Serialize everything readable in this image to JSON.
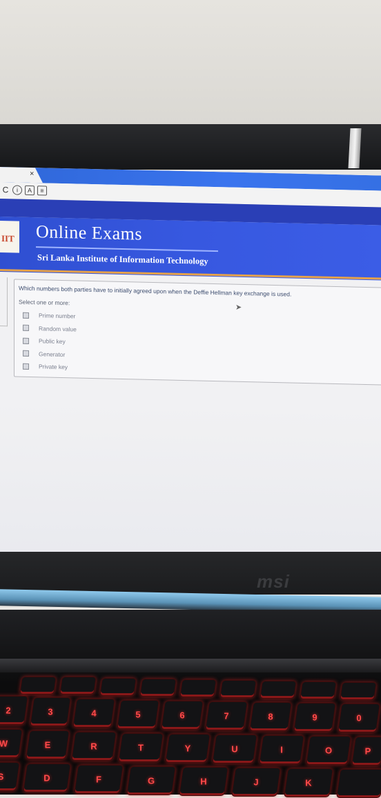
{
  "browser": {
    "tab_close": "×",
    "icons": [
      "reload-icon",
      "info-icon",
      "pdf-icon",
      "document-icon"
    ]
  },
  "brand": {
    "logo_text": "IIT",
    "title": "Online Exams",
    "subtitle": "Sri Lanka Institute of Information Technology"
  },
  "question": {
    "text": "Which numbers both parties have to initially agreed upon when the Deffie Hellman key exchange is used.",
    "prompt": "Select one or more:",
    "options": [
      {
        "label": "Prime number",
        "checked": false
      },
      {
        "label": "Random value",
        "checked": false
      },
      {
        "label": "Public key",
        "checked": false
      },
      {
        "label": "Generator",
        "checked": false
      },
      {
        "label": "Private key",
        "checked": false
      }
    ]
  },
  "laptop": {
    "brand": "msi",
    "number_row": [
      "2",
      "3",
      "4",
      "5",
      "6",
      "7",
      "8",
      "9",
      "0"
    ],
    "top_row": [
      "W",
      "E",
      "R",
      "T",
      "Y",
      "U",
      "I",
      "O",
      "P"
    ],
    "home_row": [
      "S",
      "D",
      "F",
      "G",
      "H",
      "J",
      "K"
    ]
  }
}
